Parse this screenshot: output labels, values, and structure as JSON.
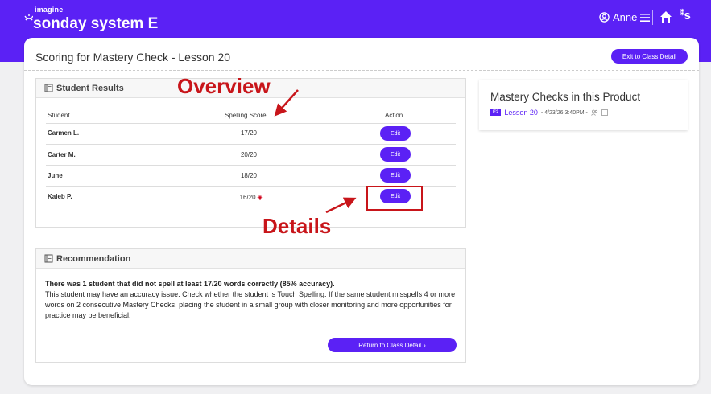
{
  "header": {
    "logo_small": "imagine",
    "logo_main": "sonday system",
    "logo_suffix": "E",
    "user_name": "Anne",
    "brand_glyph": "s",
    "icons": [
      "user-circle-icon",
      "hamburger-menu-icon",
      "home-icon",
      "brand-icon"
    ]
  },
  "page": {
    "title": "Scoring for Mastery Check - Lesson 20",
    "exit_label": "Exit to Class Detail"
  },
  "results": {
    "heading": "Student Results",
    "columns": [
      "Student",
      "Spelling Score",
      "Action"
    ],
    "rows": [
      {
        "student": "Carmen L.",
        "score": "17/20",
        "action": "Edit"
      },
      {
        "student": "Carter M.",
        "score": "20/20",
        "action": "Edit"
      },
      {
        "student": "June",
        "score": "18/20",
        "action": "Edit"
      },
      {
        "student": "Kaleb P.",
        "score": "16/20",
        "action": "Edit"
      }
    ]
  },
  "recommendation": {
    "heading": "Recommendation",
    "summary": "There was 1 student that did not spell at least 17/20 words correctly (85% accuracy).",
    "text_before": "This student may have an accuracy issue. Check whether the student is ",
    "link": "Touch Spelling",
    "text_after": ". If the same student misspells 4 or more words on 2 consecutive Mastery Checks, placing the student in a small group with closer monitoring and more opportunities for practice may be beneficial.",
    "return_label": "Return to Class Detail"
  },
  "mastery": {
    "title": "Mastery Checks in this Product",
    "tag": "E2",
    "lesson": "Lesson 20",
    "meta": "- 4/23/26 3:40PM -"
  },
  "annotations": {
    "overview": "Overview",
    "details": "Details",
    "color": "#c8151a"
  },
  "colors": {
    "primary": "#5b21f5",
    "warning": "#d0021b"
  }
}
